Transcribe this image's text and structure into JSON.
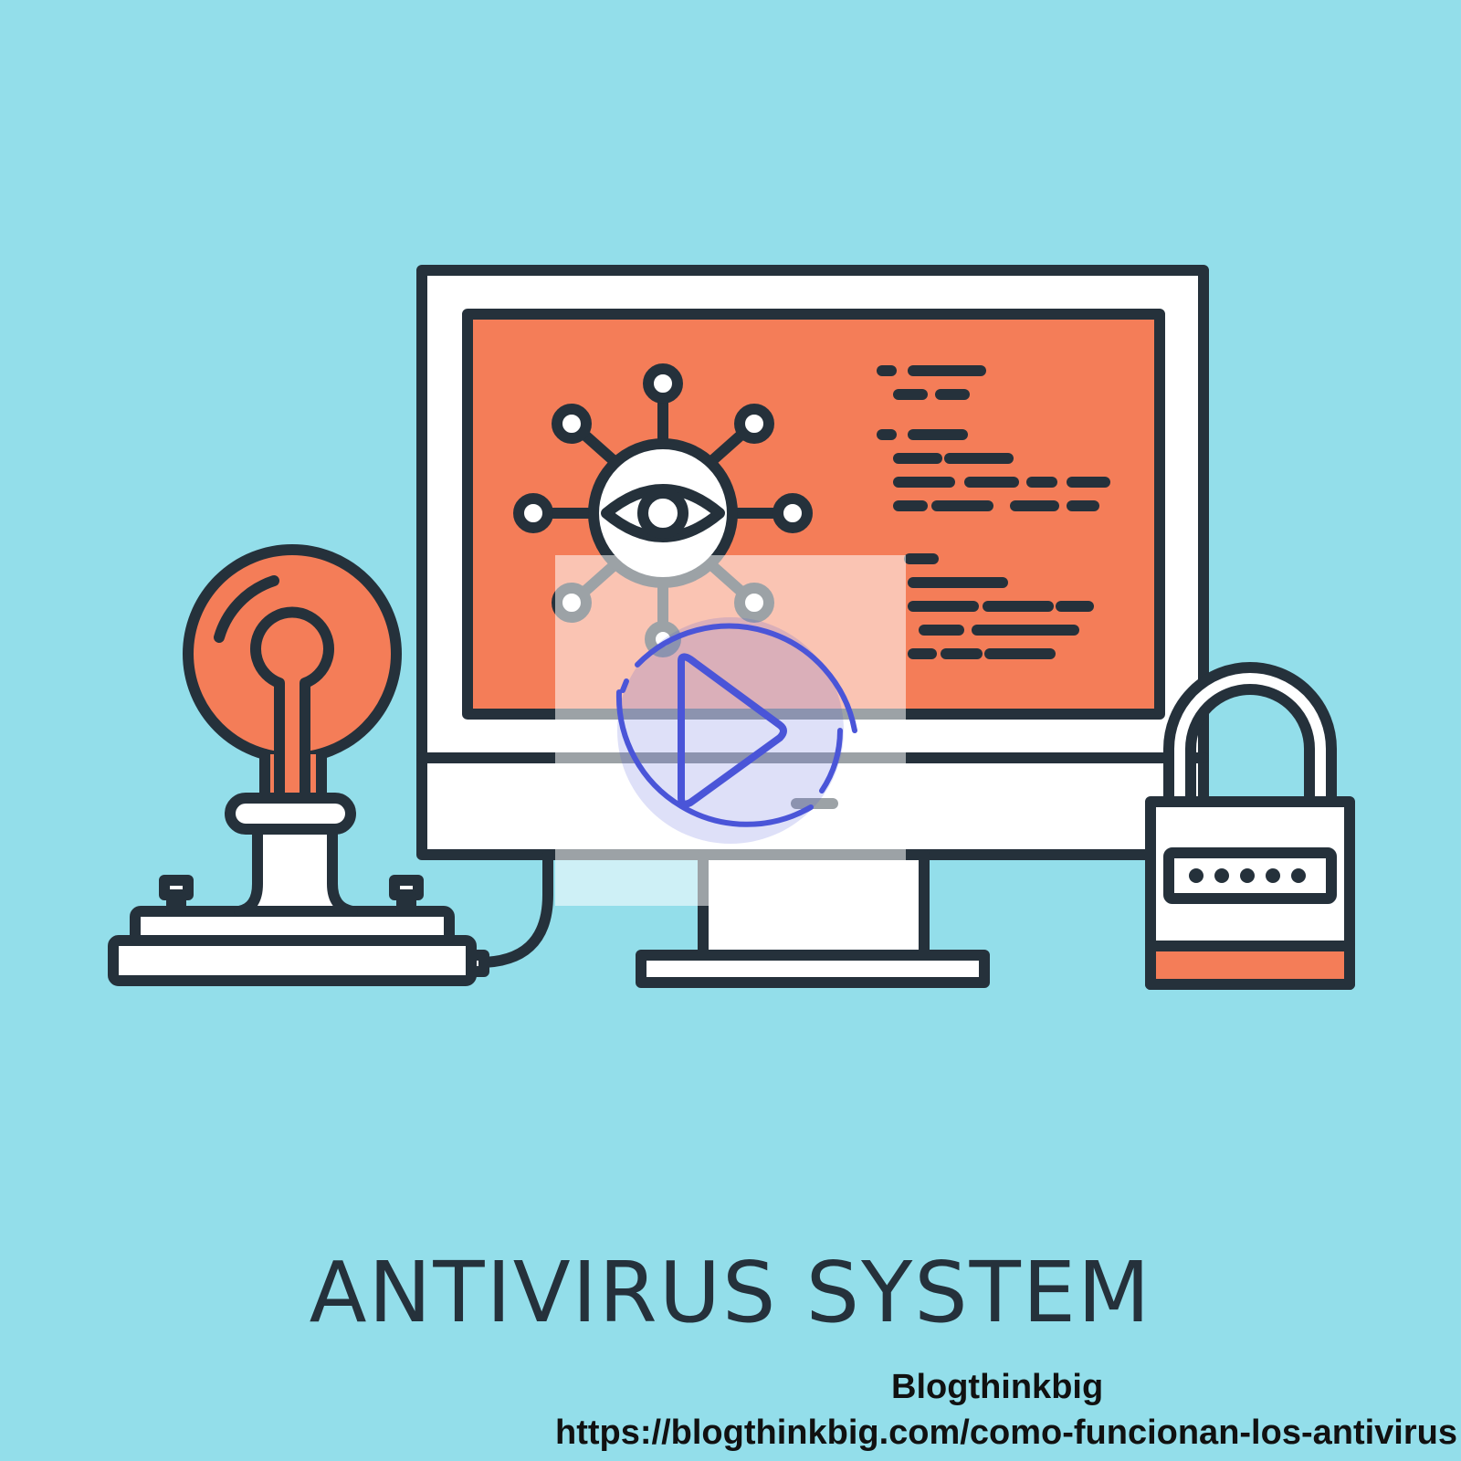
{
  "illustration": {
    "headline": "ANTIVIRUS SYSTEM",
    "icons": [
      "monitor-icon",
      "eye-network-icon",
      "code-lines-icon",
      "light-bulb-icon",
      "padlock-icon"
    ],
    "password_mask": "•••••"
  },
  "video": {
    "play_icon": "play-icon"
  },
  "source": {
    "name": "Blogthinkbig",
    "url": "https://blogthinkbig.com/como-funcionan-los-antivirus"
  },
  "colors": {
    "background": "#93DEEA",
    "accent": "#F47D58",
    "outline": "#25313B",
    "play": "#4A55D8"
  }
}
